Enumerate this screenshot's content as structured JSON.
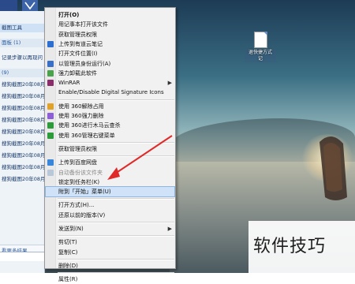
{
  "taskbar": {
    "buttons": [
      "",
      ""
    ]
  },
  "explorer_pane": {
    "items": [
      {
        "text": "截图工具",
        "style": "sel"
      },
      {
        "text": "面板 (1)",
        "style": "head"
      },
      {
        "text": "记录步骤以再现问",
        "style": "normal"
      },
      {
        "text": "(9)",
        "style": "head"
      },
      {
        "text": "搜狗截图20年08月",
        "style": "normal"
      },
      {
        "text": "搜狗截图20年08月",
        "style": "normal"
      },
      {
        "text": "搜狗截图20年08月",
        "style": "normal"
      },
      {
        "text": "搜狗截图20年08月",
        "style": "normal"
      },
      {
        "text": "搜狗截图20年08月",
        "style": "normal"
      },
      {
        "text": "搜狗截图20年08月",
        "style": "normal"
      },
      {
        "text": "搜狗截图20年08月",
        "style": "normal"
      },
      {
        "text": "搜狗截图20年08月",
        "style": "normal"
      },
      {
        "text": "搜狗截图20年08月",
        "style": "normal"
      }
    ],
    "see_more": "看更多结果"
  },
  "context_menu": {
    "items": [
      {
        "label": "打开(O)",
        "bold": true
      },
      {
        "label": "用记事本打开该文件"
      },
      {
        "label": "获取管理员权限"
      },
      {
        "label": "上传到有道云笔记",
        "icon": "youdao-icon",
        "icon_color": "#2d6fd0"
      },
      {
        "label": "打开文件位置(I)"
      },
      {
        "label": "以管理员身份运行(A)",
        "icon": "shield-icon",
        "icon_color": "#3a6fc8"
      },
      {
        "label": "强力卸载此软件",
        "icon": "uninstall-icon",
        "icon_color": "#4aa24a"
      },
      {
        "label": "WinRAR",
        "icon": "winrar-icon",
        "icon_color": "#8b2c6b",
        "submenu": true
      },
      {
        "label": "Enable/Disable Digital Signature Icons"
      },
      {
        "sep": true
      },
      {
        "label": "使用 360解除占用",
        "icon": "unlock-360-icon",
        "icon_color": "#e1a22a"
      },
      {
        "label": "使用 360强力删除",
        "icon": "delete-360-icon",
        "icon_color": "#8e5ed8"
      },
      {
        "label": "使用 360进行木马云查杀",
        "icon": "scan-360-icon",
        "icon_color": "#2e9b3a"
      },
      {
        "label": "使用 360管理右键菜单",
        "icon": "menu-360-icon",
        "icon_color": "#2e9b3a"
      },
      {
        "sep": true
      },
      {
        "label": "获取管理员权限"
      },
      {
        "sep": true
      },
      {
        "label": "上传到百度网盘",
        "icon": "baidu-pan-icon",
        "icon_color": "#3a86d8"
      },
      {
        "label": "自动备份该文件夹",
        "icon": "backup-icon",
        "icon_color": "#b8c8d8",
        "disabled": true
      },
      {
        "label": "锁定到任务栏(K)"
      },
      {
        "label": "附到「开始」菜单(U)",
        "highlighted": true
      },
      {
        "sep": true
      },
      {
        "label": "打开方式(H)..."
      },
      {
        "label": "还原以前的版本(V)"
      },
      {
        "sep": true
      },
      {
        "label": "发送到(N)",
        "submenu": true
      },
      {
        "sep": true
      },
      {
        "label": "剪切(T)"
      },
      {
        "label": "复制(C)"
      },
      {
        "sep": true
      },
      {
        "label": "删除(D)"
      },
      {
        "sep": true
      },
      {
        "label": "属性(R)"
      }
    ]
  },
  "desktop_file": {
    "name": "退快捷方式\n记"
  },
  "watermark": "软件技巧",
  "colors": {
    "arrow": "#e02a2a",
    "highlight": "#cfe2f7"
  }
}
